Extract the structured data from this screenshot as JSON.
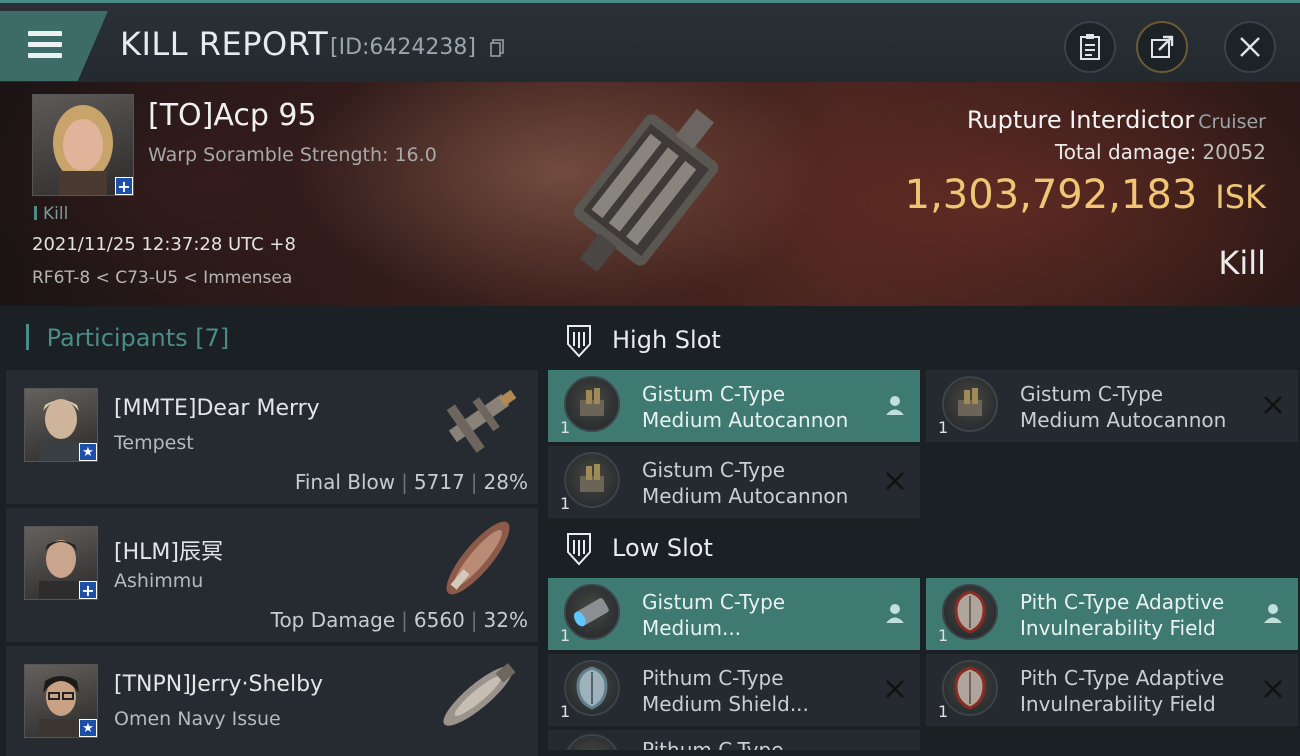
{
  "header": {
    "title": "KILL REPORT",
    "report_id": "[ID:6424238]"
  },
  "victim": {
    "name": "[TO]Acp 95",
    "detail": "Warp Soramble Strength: 16.0",
    "tag": "Kill",
    "datetime": "2021/11/25 12:37:28 UTC +8",
    "location": "RF6T-8 < C73-U5 < Immensea",
    "ship": "Rupture Interdictor",
    "ship_class": "Cruiser",
    "total_damage_label": "Total damage:",
    "total_damage": "20052",
    "isk_value": "1,303,792,183",
    "isk_unit": "ISK",
    "result": "Kill"
  },
  "participants": {
    "label": "Participants",
    "count": "[7]",
    "items": [
      {
        "name": "[MMTE]Dear Merry",
        "ship": "Tempest",
        "role": "Final Blow",
        "damage": "5717",
        "percent": "28%",
        "badge": "star"
      },
      {
        "name": "[HLM]辰冥",
        "ship": "Ashimmu",
        "role": "Top Damage",
        "damage": "6560",
        "percent": "32%",
        "badge": "plus"
      },
      {
        "name": "[TNPN]Jerry·Shelby",
        "ship": "Omen Navy Issue",
        "role": "",
        "damage": "",
        "percent": "",
        "badge": "star"
      }
    ]
  },
  "slots": {
    "high": {
      "label": "High Slot",
      "modules": [
        {
          "line1": "Gistum C-Type",
          "line2": "Medium Autocannon",
          "qty": "1",
          "state": "dropped",
          "icon": "autocannon-icon"
        },
        {
          "line1": "Gistum C-Type",
          "line2": "Medium Autocannon",
          "qty": "1",
          "state": "destroyed",
          "icon": "autocannon-icon"
        },
        {
          "line1": "Gistum C-Type",
          "line2": "Medium Autocannon",
          "qty": "1",
          "state": "destroyed",
          "icon": "autocannon-icon"
        }
      ]
    },
    "low": {
      "label": "Low Slot",
      "modules": [
        {
          "line1": "Gistum C-Type",
          "line2": "Medium...",
          "qty": "1",
          "state": "dropped",
          "icon": "shield-booster-icon"
        },
        {
          "line1": "Pith C-Type Adaptive",
          "line2": "Invulnerability Field",
          "qty": "1",
          "state": "dropped",
          "icon": "invulnerability-field-icon"
        },
        {
          "line1": "Pithum C-Type",
          "line2": "Medium Shield...",
          "qty": "1",
          "state": "destroyed",
          "icon": "shield-extender-icon"
        },
        {
          "line1": "Pith C-Type Adaptive",
          "line2": "Invulnerability Field",
          "qty": "1",
          "state": "destroyed",
          "icon": "invulnerability-field-icon"
        },
        {
          "line1": "Pithum C-Type",
          "line2": "",
          "qty": "",
          "state": "",
          "icon": "shield-extender-icon"
        }
      ]
    }
  },
  "colors": {
    "accent": "#4a8c86",
    "active_module": "#3f7a72",
    "isk": "#f0c675"
  }
}
